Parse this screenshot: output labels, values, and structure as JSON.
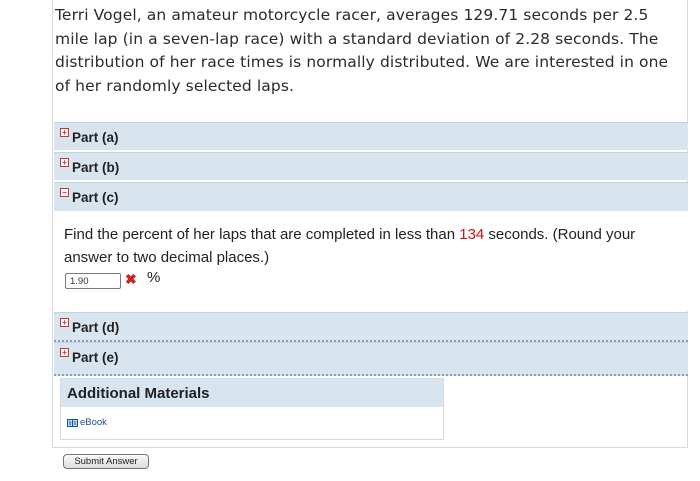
{
  "question": {
    "text": "Terri Vogel, an amateur motorcycle racer, averages 129.71 seconds per 2.5 mile lap (in a seven-lap race) with a standard deviation of 2.28 seconds. The distribution of her race times is normally distributed. We are interested in one of her randomly selected laps."
  },
  "parts": [
    {
      "label": "Part (a)",
      "expanded": false
    },
    {
      "label": "Part (b)",
      "expanded": false
    },
    {
      "label": "Part (c)",
      "expanded": true
    },
    {
      "label": "Part (d)",
      "expanded": false
    },
    {
      "label": "Part (e)",
      "expanded": false
    }
  ],
  "part_c": {
    "prompt_before": "Find the percent of her laps that are completed in less than ",
    "prompt_highlight": "134",
    "prompt_after": " seconds. (Round your answer to two decimal places.)",
    "answer_value": "1.90",
    "answer_status": "incorrect",
    "wrong_mark": "✖",
    "unit": "%"
  },
  "additional_materials": {
    "title": "Additional Materials",
    "ebook_label": "eBook"
  },
  "submit_label": "Submit Answer",
  "colors": {
    "part_header_bg": "#d8e4ee",
    "highlight_red": "#cc1111",
    "link_blue": "#1a4f8a"
  },
  "icons": {
    "collapsed": "plus-box-icon",
    "expanded": "minus-box-icon",
    "ebook": "book-icon",
    "wrong": "x-icon"
  }
}
